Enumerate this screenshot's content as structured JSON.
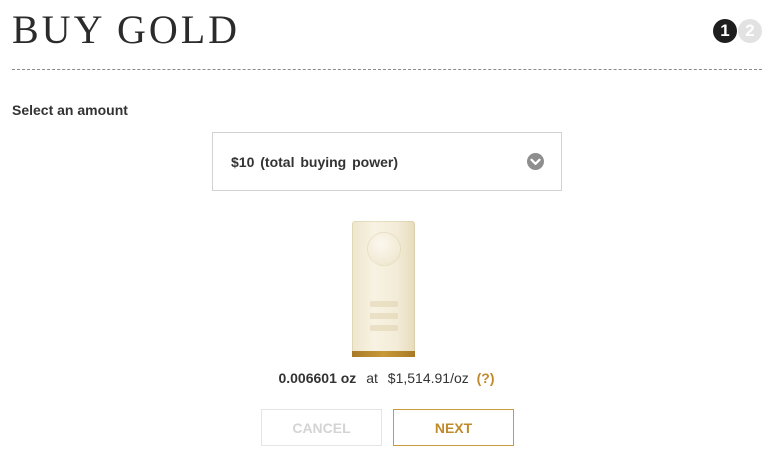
{
  "header": {
    "title": "BUY GOLD",
    "steps": [
      {
        "label": "1",
        "state": "active"
      },
      {
        "label": "2",
        "state": "inactive"
      }
    ]
  },
  "form": {
    "amount_label": "Select an amount",
    "amount_select_value": "$10 (total buying power)"
  },
  "product": {
    "image_icon": "gold-bar-icon",
    "quantity": "0.006601 oz",
    "at_label": "at",
    "price": "$1,514.91/oz",
    "help_label": "(?)"
  },
  "actions": {
    "cancel_label": "CANCEL",
    "next_label": "NEXT"
  },
  "colors": {
    "accent": "#bf8a2c",
    "step_active": "#1e1e1e",
    "step_inactive": "#e2e2e2",
    "disabled_text": "#d4d4d4"
  }
}
